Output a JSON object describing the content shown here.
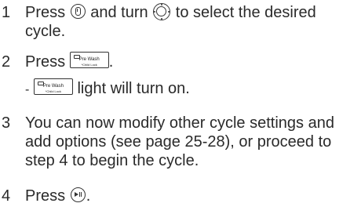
{
  "steps": [
    {
      "number": "1",
      "lines": {
        "l1_a": "Press",
        "l1_b": "and turn",
        "l1_c": "to select the desired",
        "l2": "cycle."
      }
    },
    {
      "number": "2",
      "lines": {
        "l1_a": "Press",
        "l1_end": "."
      },
      "sub": {
        "dash": "-",
        "text": "light will turn on."
      }
    },
    {
      "number": "3",
      "lines": {
        "l1": "You can now modify other cycle settings and",
        "l2": "add options (see page 25-28), or proceed to",
        "l3": "step 4 to begin the cycle."
      }
    },
    {
      "number": "4",
      "lines": {
        "l1_a": "Press",
        "l1_end": "."
      }
    }
  ],
  "prewash_button": {
    "label": "Pre Wash",
    "sublabel": "*Child Lock"
  },
  "icons": {
    "power": "power-button-icon",
    "dial": "cycle-dial-icon",
    "start": "start-pause-icon"
  }
}
